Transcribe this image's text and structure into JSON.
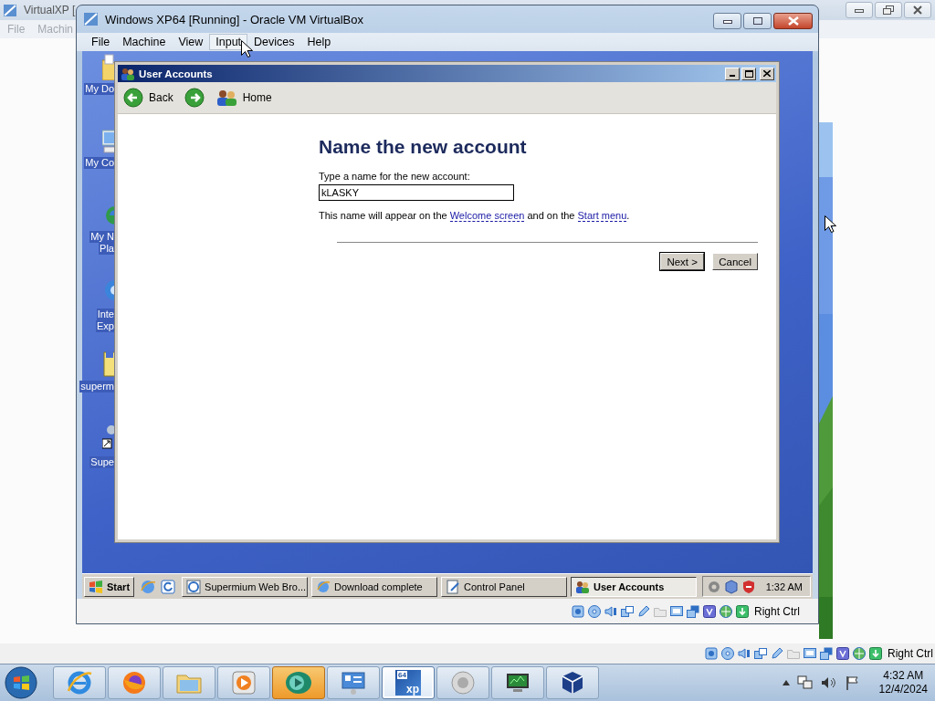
{
  "host_window": {
    "title": "VirtualXP [",
    "menu": [
      "File",
      "Machin"
    ],
    "status_key": "Right Ctrl"
  },
  "vbox_window": {
    "title": "Windows XP64 [Running] - Oracle VM VirtualBox",
    "menu": [
      {
        "label": "File",
        "selected": false
      },
      {
        "label": "Machine",
        "selected": false
      },
      {
        "label": "View",
        "selected": false
      },
      {
        "label": "Input",
        "selected": true
      },
      {
        "label": "Devices",
        "selected": false
      },
      {
        "label": "Help",
        "selected": false
      }
    ],
    "status_key": "Right Ctrl"
  },
  "guest_desktop": {
    "icons": [
      {
        "kind": "documents",
        "lines": [
          "My Do"
        ]
      },
      {
        "kind": "computer",
        "lines": [
          "My Co"
        ]
      },
      {
        "kind": "network",
        "lines": [
          "My N",
          "Pla"
        ]
      },
      {
        "kind": "ie",
        "lines": [
          "Inte",
          "Exp"
        ]
      },
      {
        "kind": "installer",
        "lines": [
          "superm"
        ]
      },
      {
        "kind": "shortcut",
        "lines": [
          "Supe"
        ]
      }
    ]
  },
  "user_accounts": {
    "title": "User Accounts",
    "toolbar": [
      {
        "kind": "back",
        "label": "Back"
      },
      {
        "kind": "forward"
      },
      {
        "kind": "home",
        "label": "Home"
      }
    ],
    "heading": "Name the new account",
    "prompt": "Type a name for the new account:",
    "name_value": "kLASKY",
    "note": [
      {
        "text": "This name will appear on the "
      },
      {
        "link": "Welcome screen"
      },
      {
        "text": " and on the "
      },
      {
        "link": "Start menu"
      },
      {
        "text": "."
      }
    ],
    "buttons": [
      "Next >",
      "Cancel"
    ]
  },
  "xp_taskbar": {
    "start": "Start",
    "tasks": [
      {
        "kind": "browser",
        "label": "Supermium Web Bro...",
        "selected": false
      },
      {
        "kind": "ie",
        "label": "Download complete",
        "selected": false
      },
      {
        "kind": "control",
        "label": "Control Panel",
        "selected": false
      },
      {
        "kind": "users",
        "label": "User Accounts",
        "selected": true
      }
    ],
    "clock": "1:32 AM"
  },
  "win7_taskbar": {
    "apps": [
      {
        "kind": "ie",
        "selected": false,
        "attention": false
      },
      {
        "kind": "firefox",
        "selected": false,
        "attention": false
      },
      {
        "kind": "explorer",
        "selected": false,
        "attention": false
      },
      {
        "kind": "media",
        "selected": false,
        "attention": false
      },
      {
        "kind": "green_app",
        "selected": false,
        "attention": true
      },
      {
        "kind": "control",
        "selected": false,
        "attention": false
      },
      {
        "kind": "vm_xp",
        "selected": true,
        "attention": false,
        "badge": "64",
        "caption": "xp"
      },
      {
        "kind": "speaker",
        "selected": false,
        "attention": false
      },
      {
        "kind": "monitor",
        "selected": false,
        "attention": false
      },
      {
        "kind": "vbox",
        "selected": false,
        "attention": false
      }
    ],
    "time": "4:32 AM",
    "date": "12/4/2024"
  }
}
